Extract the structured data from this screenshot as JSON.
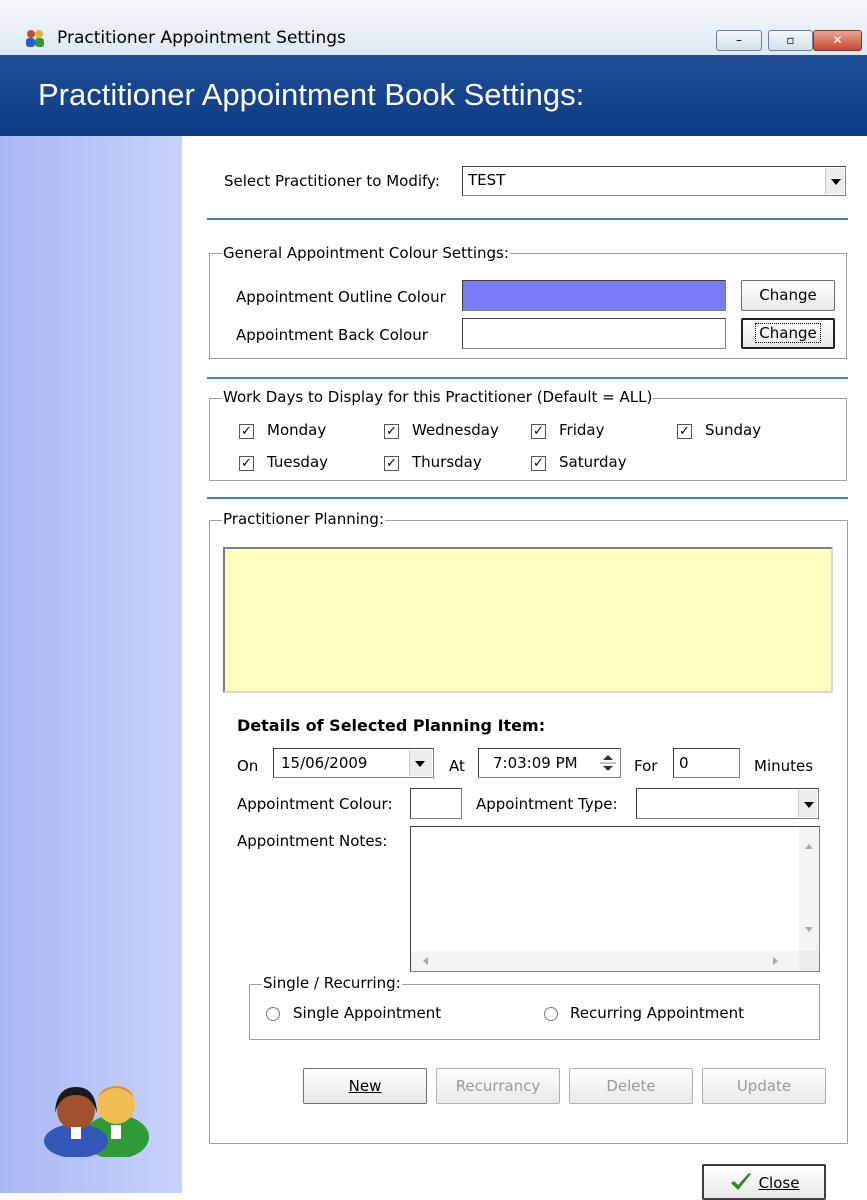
{
  "window": {
    "title": "Practitioner Appointment Settings",
    "minimize_glyph": "–",
    "maximize_glyph": "▫",
    "close_glyph": "✕"
  },
  "header": {
    "title": "Practitioner Appointment Book Settings:"
  },
  "practitioner": {
    "label": "Select Practitioner to Modify:",
    "value": "TEST"
  },
  "colour_settings": {
    "legend": "General Appointment Colour Settings:",
    "outline_label": "Appointment Outline Colour",
    "outline_colour": "#7b7bf5",
    "back_label": "Appointment Back Colour",
    "back_colour": "#ffffff",
    "change_label": "Change",
    "change2_label": "Change"
  },
  "work_days": {
    "legend": "Work Days to Display for this Practitioner (Default = ALL)",
    "days": [
      {
        "label": "Monday",
        "checked": true
      },
      {
        "label": "Tuesday",
        "checked": true
      },
      {
        "label": "Wednesday",
        "checked": true
      },
      {
        "label": "Thursday",
        "checked": true
      },
      {
        "label": "Friday",
        "checked": true
      },
      {
        "label": "Saturday",
        "checked": true
      },
      {
        "label": "Sunday",
        "checked": true
      }
    ]
  },
  "planning": {
    "legend": "Practitioner Planning:",
    "list_colour": "#ffffc0",
    "details_heading": "Details of Selected Planning Item:",
    "on_label": "On",
    "date_value": "15/06/2009",
    "at_label": "At",
    "time_value": "7:03:09 PM",
    "for_label": "For",
    "minutes_value": "0",
    "minutes_label": "Minutes",
    "appt_colour_label": "Appointment Colour:",
    "appt_type_label": "Appointment Type:",
    "appt_type_value": "",
    "notes_label": "Appointment Notes:",
    "notes_value": "",
    "recurring": {
      "legend": "Single / Recurring:",
      "single_label": "Single Appointment",
      "recurring_label": "Recurring Appointment"
    },
    "buttons": {
      "new": "New",
      "recurrancy": "Recurrancy",
      "delete": "Delete",
      "update": "Update"
    }
  },
  "close_button": {
    "label": "Close",
    "icon": "checkmark-icon"
  }
}
